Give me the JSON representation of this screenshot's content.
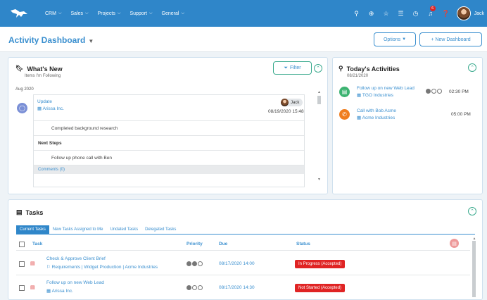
{
  "nav": {
    "menu": [
      {
        "label": "CRM"
      },
      {
        "label": "Sales"
      },
      {
        "label": "Projects"
      },
      {
        "label": "Support"
      },
      {
        "label": "General"
      }
    ],
    "notification_count": "6",
    "user": "Jack"
  },
  "header": {
    "title": "Activity Dashboard",
    "options_label": "Options",
    "new_dashboard_label": "+ New Dashboard"
  },
  "whats_new": {
    "title": "What's New",
    "subtitle": "Items I'm Following",
    "filter_label": "Filter",
    "date_group": "Aug 2020",
    "item": {
      "type": "Update",
      "company": "Arissa Inc.",
      "user": "Jack",
      "timestamp": "08/19/2020 15:48",
      "note": "Completed background research",
      "next_steps_label": "Next Steps",
      "next_step": "Follow up phone call with Ben",
      "comments": "Comments (0)"
    }
  },
  "today": {
    "title": "Today's Activities",
    "date": "08/21/2020",
    "activities": [
      {
        "title": "Follow up on new Web Lead",
        "company": "TGO Industries",
        "time": "02:30 PM",
        "priority": 1,
        "color": "#3cb371"
      },
      {
        "title": "Call with Bob Acme",
        "company": "Acme Industries",
        "time": "05:00 PM",
        "color": "#f07d1e"
      }
    ]
  },
  "tasks": {
    "title": "Tasks",
    "tabs": [
      "Current Tasks",
      "New Tasks Assigned to Me",
      "Undated Tasks",
      "Delegated Tasks"
    ],
    "columns": {
      "task": "Task",
      "priority": "Priority",
      "due": "Due",
      "status": "Status"
    },
    "rows": [
      {
        "title": "Check & Approve Client Brief",
        "sub": "Requirements | Widget Production | Acme Industries",
        "priority": 2,
        "due": "08/17/2020 14:00",
        "status": "In Progress (Accepted)"
      },
      {
        "title": "Follow up on new Web Lead",
        "sub": "Arissa Inc.",
        "priority": 1,
        "due": "08/17/2020 14:30",
        "status": "Not Started (Accepted)"
      }
    ]
  }
}
